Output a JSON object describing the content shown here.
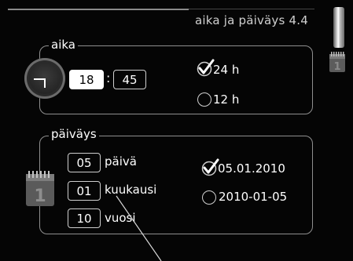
{
  "header": {
    "title": "aika ja päiväys 4.4"
  },
  "time_panel": {
    "label": "aika",
    "hours": "18",
    "separator": ":",
    "minutes": "45",
    "formats": [
      {
        "label": "24 h",
        "selected": true
      },
      {
        "label": "12 h",
        "selected": false
      }
    ]
  },
  "date_panel": {
    "label": "päiväys",
    "day_value": "05",
    "day_label": "päivä",
    "month_value": "01",
    "month_label": "kuukausi",
    "year_value": "10",
    "year_label": "vuosi",
    "formats": [
      {
        "label": "05.01.2010",
        "selected": true
      },
      {
        "label": "2010-01-05",
        "selected": false
      }
    ]
  },
  "icons": {
    "clock": "clock-icon",
    "calendar": "calendar-icon",
    "check": "checkmark-icon",
    "scroll": "scrollbar-thumb"
  },
  "colors": {
    "background": "#050505",
    "border": "#8f8f8f",
    "text": "#ffffff"
  }
}
